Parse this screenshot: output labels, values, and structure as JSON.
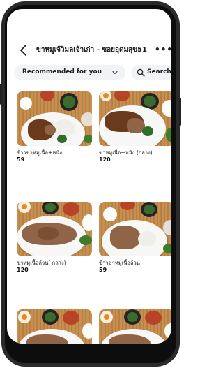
{
  "header": {
    "title": "ขาหมูเจ๊วิมลเจ้าเก่า - ซอยอุดมสุข51",
    "back_icon": "chevron-left-icon",
    "more_icon": "more-horizontal-icon"
  },
  "filter": {
    "sort_label": "Recommended for you",
    "sort_icon": "chevron-down-icon",
    "search_label": "Search",
    "search_icon": "search-icon"
  },
  "items": [
    {
      "name": "ข้าวขาหมูเนื้อ+หนัง",
      "price": "59"
    },
    {
      "name": "ขาหมูเนื้อ+หนัง (กลาง)",
      "price": "120"
    },
    {
      "name": "ขาหมูเนื้อล้วน( กลาง)",
      "price": "120"
    },
    {
      "name": "ข้าวขาหมูเนื้อล้วน",
      "price": "59"
    },
    {
      "name": "",
      "price": ""
    },
    {
      "name": "",
      "price": ""
    }
  ]
}
